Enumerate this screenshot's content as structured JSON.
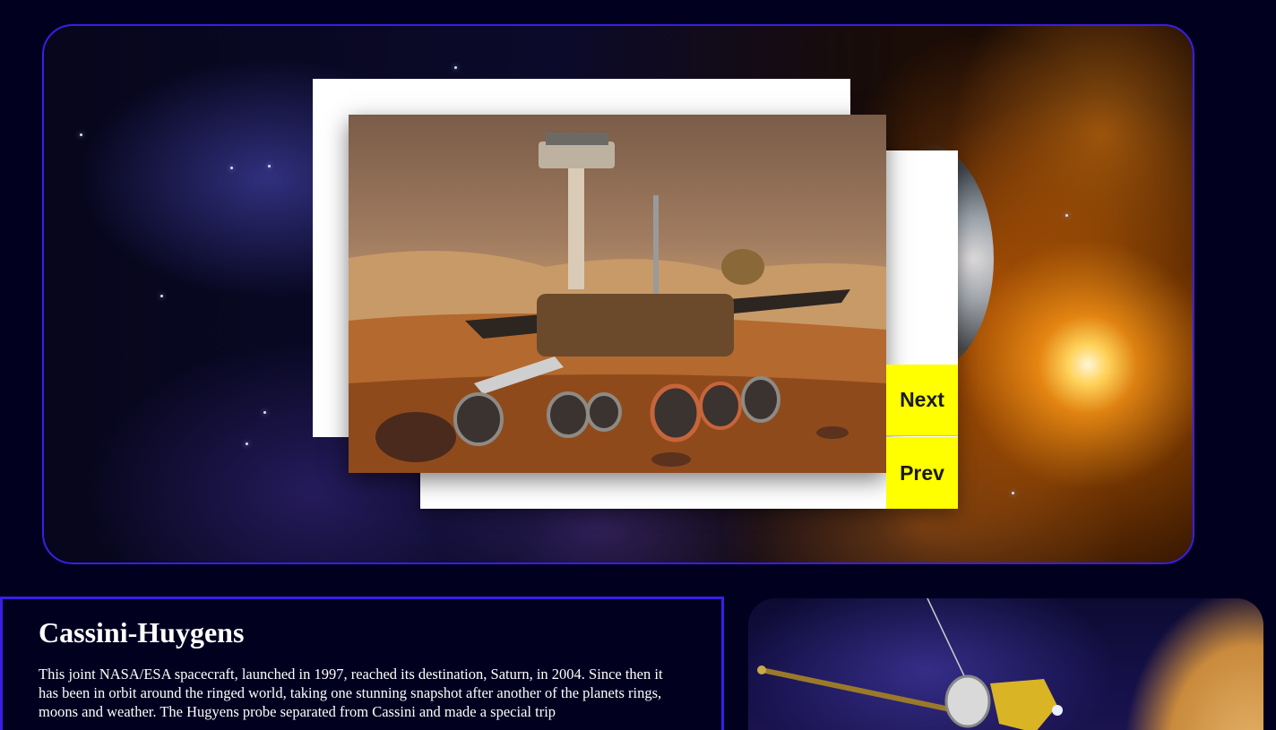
{
  "slideshow": {
    "image_alt": "Mars Exploration Rover on Martian terrain",
    "next_label": "Next",
    "prev_label": "Prev"
  },
  "info": {
    "title": "Cassini-Huygens",
    "body": "This joint NASA/ESA spacecraft, launched in 1997, reached its destination, Saturn, in 2004. Since then it has been in orbit around the ringed world, taking one stunning snapshot after another of the planets rings, moons and weather. The Hugyens probe separated from Cassini and made a special trip"
  },
  "cassini_image": {
    "alt": "Cassini spacecraft near Saturn"
  },
  "colors": {
    "background": "#02001f",
    "border_accent": "#3a1ee6",
    "button": "#ffff00"
  }
}
